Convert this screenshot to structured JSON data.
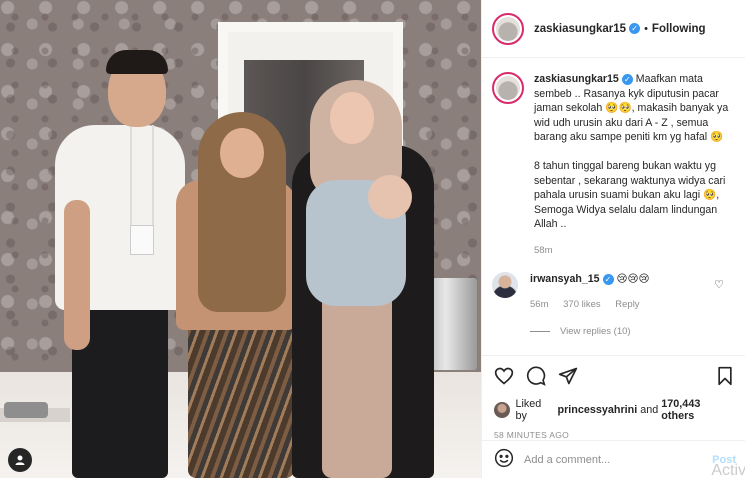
{
  "post": {
    "username": "zaskiasungkar15",
    "follow_status": "Following",
    "header_separator": "•"
  },
  "caption": {
    "username": "zaskiasungkar15",
    "text": "Maafkan mata sembeb .. Rasanya kyk diputusin pacar jaman sekolah 🥺🥺, makasih banyak ya wid udh urusin aku dari A - Z , semua barang aku sampe peniti km yg hafal 🥺\n\n8 tahun tinggal bareng bukan waktu yg sebentar , sekarang waktunya widya cari pahala urusin suami bukan aku lagi 🥺, Semoga Widya selalu dalam lindungan Allah ..",
    "time": "58m"
  },
  "comments": [
    {
      "username": "irwansyah_15",
      "text": "😢😢😢",
      "time": "56m",
      "likes": "370 likes",
      "reply_label": "Reply",
      "view_replies": "View replies (10)"
    }
  ],
  "likes": {
    "prefix": "Liked by",
    "user": "princessyahrini",
    "connector": "and",
    "others": "170,443 others"
  },
  "timestamp": "58 MINUTES AGO",
  "add_comment": {
    "placeholder": "Add a comment...",
    "post_label": "Post"
  },
  "watermark": "Activ",
  "icons": {
    "like": "heart-icon",
    "comment": "comment-icon",
    "share": "share-icon",
    "save": "bookmark-icon",
    "emoji": "emoji-icon",
    "verified": "verified-badge-icon",
    "user_tags": "user-tag-icon"
  },
  "colors": {
    "verified_blue": "#3897f0",
    "story_ring": "#d92b6b",
    "muted_text": "#8e8e8e",
    "post_button": "#b2dffc"
  }
}
